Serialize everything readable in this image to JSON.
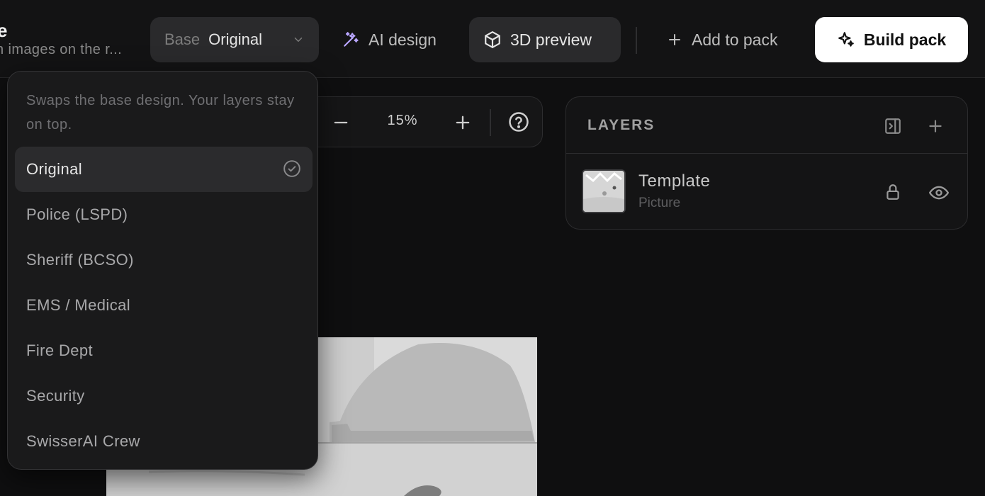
{
  "header": {
    "title": "e",
    "subtitle": "n images on the r..."
  },
  "base_select": {
    "label": "Base",
    "value": "Original"
  },
  "toolbar": {
    "ai_design_label": "AI design",
    "preview_label": "3D preview",
    "add_to_pack_label": "Add to pack",
    "build_pack_label": "Build pack"
  },
  "zoom": {
    "value": "15%"
  },
  "layers": {
    "title": "LAYERS",
    "items": [
      {
        "name": "Template",
        "type": "Picture"
      }
    ]
  },
  "dropdown": {
    "help_text": "Swaps the base design. Your layers stay on top.",
    "options": [
      {
        "label": "Original"
      },
      {
        "label": "Police (LSPD)"
      },
      {
        "label": "Sheriff (BCSO)"
      },
      {
        "label": "EMS / Medical"
      },
      {
        "label": "Fire Dept"
      },
      {
        "label": "Security"
      },
      {
        "label": "SwisserAI Crew"
      }
    ],
    "selected": "Original"
  },
  "colors": {
    "background": "#0f0f10",
    "surface": "#2a2a2c",
    "primary_button": "#ffffff",
    "ai_accent": "#b9a6ff"
  }
}
